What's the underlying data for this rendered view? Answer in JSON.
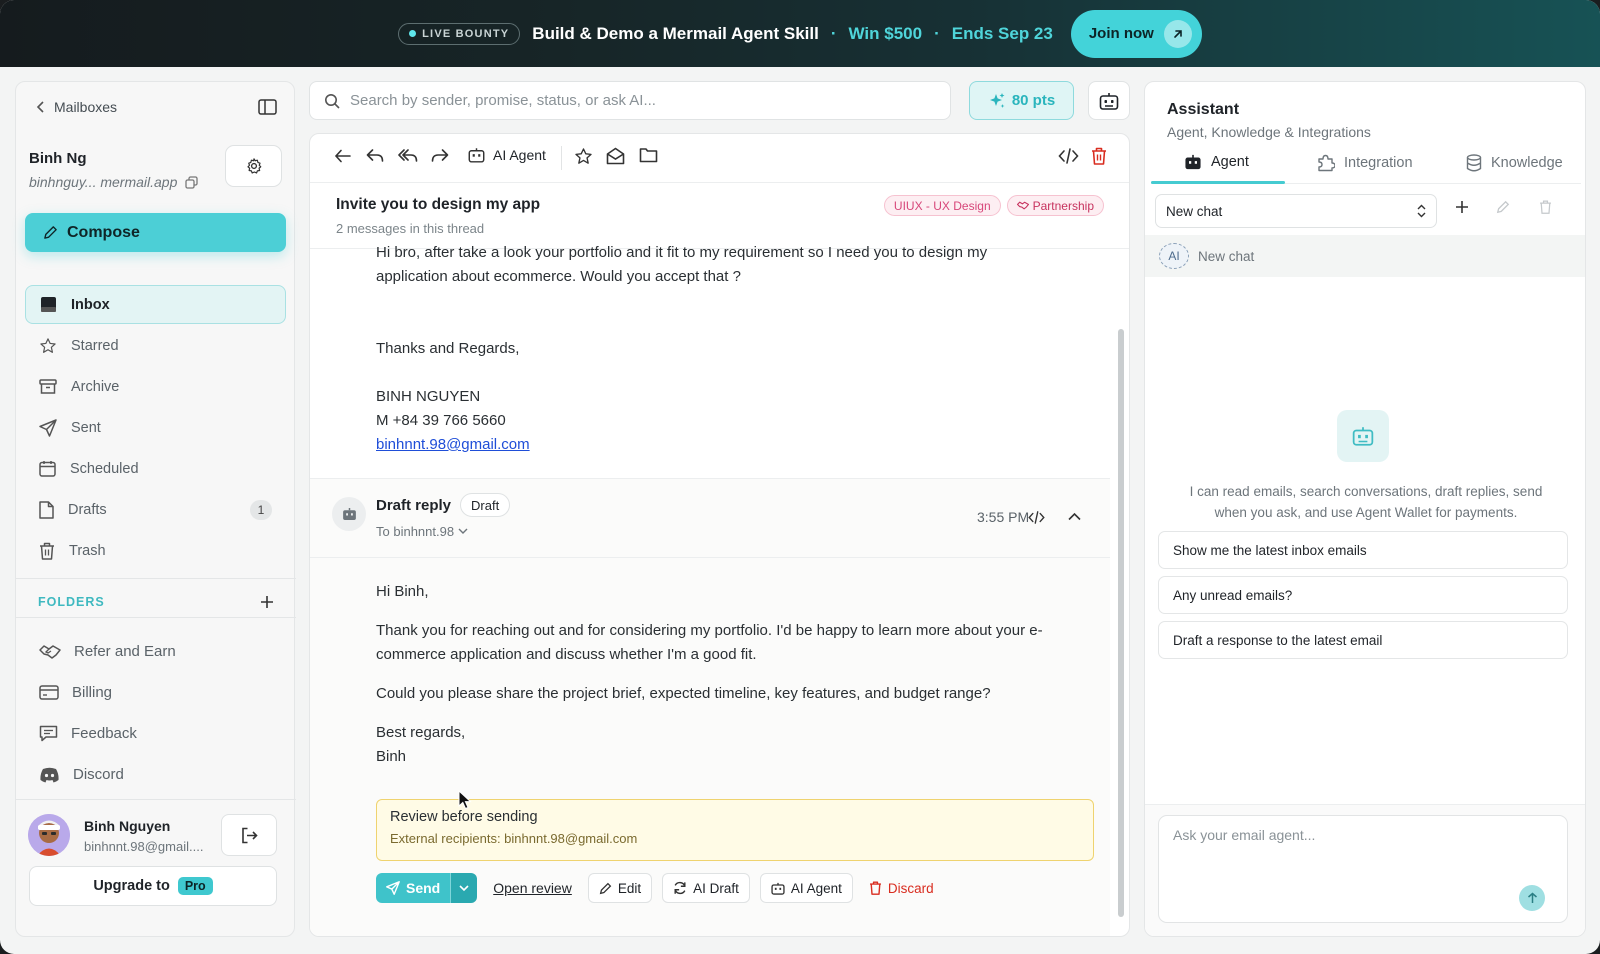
{
  "banner": {
    "bounty_label": "LIVE BOUNTY",
    "title": "Build & Demo a Mermail Agent Skill",
    "sep1": "·",
    "prize": "Win $500",
    "sep2": "·",
    "deadline": "Ends Sep 23",
    "join_label": "Join now"
  },
  "sidebar": {
    "back_label": "Mailboxes",
    "user_name": "Binh Ng",
    "user_email": "binhnguy... mermail.app",
    "compose_label": "Compose",
    "nav": [
      {
        "label": "Inbox",
        "icon": "inbox-icon",
        "active": true
      },
      {
        "label": "Starred",
        "icon": "star-icon"
      },
      {
        "label": "Archive",
        "icon": "archive-icon"
      },
      {
        "label": "Sent",
        "icon": "send-icon"
      },
      {
        "label": "Scheduled",
        "icon": "calendar-icon"
      },
      {
        "label": "Drafts",
        "icon": "file-icon",
        "badge": "1"
      },
      {
        "label": "Trash",
        "icon": "trash-icon"
      }
    ],
    "folders_label": "FOLDERS",
    "folders": [
      {
        "label": "Refer and Earn",
        "icon": "handshake-icon"
      },
      {
        "label": "Billing",
        "icon": "credit-card-icon"
      },
      {
        "label": "Feedback",
        "icon": "message-icon"
      },
      {
        "label": "Discord",
        "icon": "discord-icon"
      }
    ],
    "footer": {
      "name": "Binh Nguyen",
      "email": "binhnnt.98@gmail....",
      "upgrade_label": "Upgrade to",
      "pro_label": "Pro"
    }
  },
  "search": {
    "placeholder": "Search by sender, promise, status, or ask AI..."
  },
  "points": {
    "label": "80 pts"
  },
  "mail": {
    "toolbar": {
      "ai_agent_label": "AI Agent"
    },
    "subject": "Invite you to design my app",
    "thread_count": "2 messages in this thread",
    "tags": [
      "UIUX - UX Design",
      "Partnership"
    ],
    "message": {
      "line1": "Hi bro, after take a look your portfolio and it fit to my requirement so I need you to design my",
      "line2": "application about ecommerce. Would you accept that ?",
      "closing": "Thanks and Regards,",
      "sig_name": "BINH NGUYEN",
      "sig_phone": "M +84 39 766 5660",
      "sig_email": "binhnnt.98@gmail.com"
    },
    "draft": {
      "title": "Draft reply",
      "pill": "Draft",
      "to": "To binhnnt.98",
      "time": "3:55 PM",
      "greeting": "Hi Binh,",
      "para1a": "Thank you for reaching out and for considering my portfolio. I'd be happy to learn more about your e-",
      "para1b": "commerce application and discuss whether I'm a good fit.",
      "para2": "Could you please share the project brief, expected timeline, key features, and budget range?",
      "signoff": "Best regards,",
      "signname": "Binh",
      "review_title": "Review before sending",
      "review_sub": "External recipients: binhnnt.98@gmail.com",
      "send_label": "Send",
      "open_review_label": "Open review",
      "edit_label": "Edit",
      "ai_draft_label": "AI Draft",
      "ai_agent_label": "AI Agent",
      "discard_label": "Discard"
    }
  },
  "assistant": {
    "title": "Assistant",
    "subtitle": "Agent, Knowledge & Integrations",
    "tabs": [
      "Agent",
      "Integration",
      "Knowledge"
    ],
    "chat_select": "New chat",
    "chat_row_chip": "AI",
    "chat_row_label": "New chat",
    "empty_text": "I can read emails, search conversations, draft replies, send when you ask, and use Agent Wallet for payments.",
    "suggestions": [
      "Show me the latest inbox emails",
      "Any unread emails?",
      "Draft a response to the latest email"
    ],
    "input_placeholder": "Ask your email agent..."
  },
  "colors": {
    "accent": "#4ccfd6",
    "danger": "#d92d20",
    "banner_bg": "#151b1e"
  }
}
